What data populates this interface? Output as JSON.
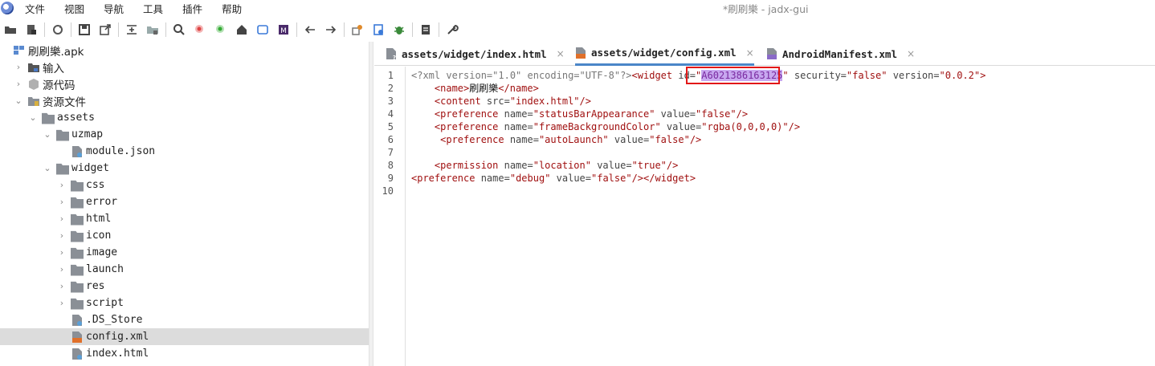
{
  "window": {
    "title": "*刷刷樂 - jadx-gui"
  },
  "menu": [
    "文件",
    "视图",
    "导航",
    "工具",
    "插件",
    "帮助"
  ],
  "toolbar": {
    "buttons": [
      "open-icon",
      "add-files-icon",
      "sync-icon",
      "save-icon",
      "export-icon",
      "flatten-icon",
      "packages-icon",
      "search-icon",
      "find-class-icon",
      "find-usage-icon",
      "home-icon",
      "log-icon",
      "mark-icon",
      "back-icon",
      "forward-icon",
      "settings-deob-icon",
      "quark-icon",
      "debug-icon",
      "log-viewer-icon",
      "preferences-icon"
    ]
  },
  "tree": [
    {
      "label": "刷刷樂.apk",
      "indent": 0,
      "icon": "apk-icon",
      "chevron": ""
    },
    {
      "label": "输入",
      "indent": 1,
      "icon": "input-icon",
      "chevron": "›"
    },
    {
      "label": "源代码",
      "indent": 1,
      "icon": "package-icon",
      "chevron": "›"
    },
    {
      "label": "资源文件",
      "indent": 1,
      "icon": "resources-icon",
      "chevron": "⌄"
    },
    {
      "label": "assets",
      "indent": 2,
      "icon": "folder-icon",
      "chevron": "⌄"
    },
    {
      "label": "uzmap",
      "indent": 3,
      "icon": "folder-icon",
      "chevron": "⌄"
    },
    {
      "label": "module.json",
      "indent": 4,
      "icon": "file-icon",
      "chevron": ""
    },
    {
      "label": "widget",
      "indent": 3,
      "icon": "folder-icon",
      "chevron": "⌄"
    },
    {
      "label": "css",
      "indent": 4,
      "icon": "folder-icon",
      "chevron": "›"
    },
    {
      "label": "error",
      "indent": 4,
      "icon": "folder-icon",
      "chevron": "›"
    },
    {
      "label": "html",
      "indent": 4,
      "icon": "folder-icon",
      "chevron": "›"
    },
    {
      "label": "icon",
      "indent": 4,
      "icon": "folder-icon",
      "chevron": "›"
    },
    {
      "label": "image",
      "indent": 4,
      "icon": "folder-icon",
      "chevron": "›"
    },
    {
      "label": "launch",
      "indent": 4,
      "icon": "folder-icon",
      "chevron": "›"
    },
    {
      "label": "res",
      "indent": 4,
      "icon": "folder-icon",
      "chevron": "›"
    },
    {
      "label": "script",
      "indent": 4,
      "icon": "folder-icon",
      "chevron": "›"
    },
    {
      "label": ".DS_Store",
      "indent": 4,
      "icon": "file-icon",
      "chevron": ""
    },
    {
      "label": "config.xml",
      "indent": 4,
      "icon": "xml-file-icon",
      "chevron": "",
      "selected": true
    },
    {
      "label": "index.html",
      "indent": 4,
      "icon": "file-icon",
      "chevron": ""
    }
  ],
  "tabs": [
    {
      "label": "assets/widget/index.html",
      "close": "×",
      "active": false
    },
    {
      "label": "assets/widget/config.xml",
      "close": "×",
      "active": true
    },
    {
      "label": "AndroidManifest.xml",
      "close": "×",
      "active": false
    }
  ],
  "editor": {
    "line_numbers": [
      "1",
      "2",
      "3",
      "4",
      "5",
      "6",
      "7",
      "8",
      "9",
      "10"
    ],
    "lines": [
      [
        [
          "pi",
          "<?xml version=\"1.0\" encoding=\"UTF-8\"?>"
        ],
        [
          "tag",
          "<widget"
        ],
        [
          "attr",
          " id="
        ],
        [
          "val",
          "\""
        ],
        [
          "hl",
          "A6021386163125"
        ],
        [
          "val",
          "\""
        ],
        [
          "attr",
          " security="
        ],
        [
          "val",
          "\"false\""
        ],
        [
          "attr",
          " version="
        ],
        [
          "val",
          "\"0.0.2\""
        ],
        [
          "tag",
          ">"
        ]
      ],
      [
        [
          "tag",
          "    <name>"
        ],
        [
          "txt",
          "刷刷樂"
        ],
        [
          "tag",
          "</name>"
        ]
      ],
      [
        [
          "tag",
          "    <content"
        ],
        [
          "attr",
          " src="
        ],
        [
          "val",
          "\"index.html\""
        ],
        [
          "tag",
          "/>"
        ]
      ],
      [
        [
          "tag",
          "    <preference"
        ],
        [
          "attr",
          " name="
        ],
        [
          "val",
          "\"statusBarAppearance\""
        ],
        [
          "attr",
          " value="
        ],
        [
          "val",
          "\"false\""
        ],
        [
          "tag",
          "/>"
        ]
      ],
      [
        [
          "tag",
          "    <preference"
        ],
        [
          "attr",
          " name="
        ],
        [
          "val",
          "\"frameBackgroundColor\""
        ],
        [
          "attr",
          " value="
        ],
        [
          "val",
          "\"rgba(0,0,0,0)\""
        ],
        [
          "tag",
          "/>"
        ]
      ],
      [
        [
          "tag",
          "     <preference"
        ],
        [
          "attr",
          " name="
        ],
        [
          "val",
          "\"autoLaunch\""
        ],
        [
          "attr",
          " value="
        ],
        [
          "val",
          "\"false\""
        ],
        [
          "tag",
          "/>"
        ]
      ],
      [],
      [
        [
          "tag",
          "    <permission"
        ],
        [
          "attr",
          " name="
        ],
        [
          "val",
          "\"location\""
        ],
        [
          "attr",
          " value="
        ],
        [
          "val",
          "\"true\""
        ],
        [
          "tag",
          "/>"
        ]
      ],
      [
        [
          "tag",
          "<preference"
        ],
        [
          "attr",
          " name="
        ],
        [
          "val",
          "\"debug\""
        ],
        [
          "attr",
          " value="
        ],
        [
          "val",
          "\"false\""
        ],
        [
          "tag",
          "/></widget>"
        ]
      ],
      []
    ],
    "highlighted_id": "A6021386163125"
  },
  "colors": {
    "highlight_box": "#e21818",
    "selection": "#dcdcdc",
    "tag": "#a01010",
    "active_tab_underline": "#4a86c8"
  }
}
